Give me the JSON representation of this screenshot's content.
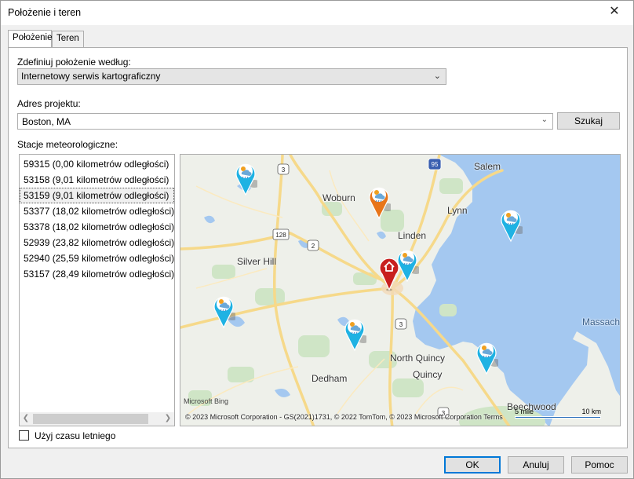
{
  "window": {
    "title": "Położenie i teren",
    "close_glyph": "✕"
  },
  "tabs": [
    {
      "label": "Położenie",
      "active": true
    },
    {
      "label": "Teren",
      "active": false
    }
  ],
  "location": {
    "define_label": "Zdefiniuj położenie według:",
    "define_value": "Internetowy serwis kartograficzny",
    "address_label": "Adres projektu:",
    "address_value": "Boston, MA",
    "search_button": "Szukaj"
  },
  "stations": {
    "label": "Stacje meteorologiczne:",
    "selected_index": 2,
    "items": [
      "59315 (0,00 kilometrów odległości)",
      "53158 (9,01 kilometrów odległości)",
      "53159 (9,01 kilometrów odległości)",
      "53377 (18,02 kilometrów odległości)",
      "53378 (18,02 kilometrów odległości)",
      "52939 (23,82 kilometrów odległości)",
      "52940 (25,59 kilometrów odległości)",
      "53157 (28,49 kilometrów odległości)"
    ]
  },
  "map": {
    "place_labels": [
      "Salem",
      "Woburn",
      "Lynn",
      "Linden",
      "Silver Hill",
      "North Quincy",
      "Quincy",
      "Dedham",
      "Beechwood",
      "Massach"
    ],
    "route_shields": [
      "3",
      "95",
      "128",
      "2",
      "3",
      "3"
    ],
    "bing_logo": "Microsoft Bing",
    "copyright": "© 2023 Microsoft Corporation - GS(2021)1731, © 2022 TomTom, © 2023 Microsoft Corporation  Terms",
    "scale_miles": "5 mile",
    "scale_km": "10 km",
    "colors": {
      "water": "#a4c8f0",
      "land": "#eef0ea",
      "park": "#cfe5c6",
      "road": "#f6d98a",
      "pin_weather": "#1fb2e3",
      "pin_selected": "#e8751a",
      "pin_home": "#c8201f"
    },
    "pins": [
      {
        "name": "weather-pin",
        "icon": "weather-icon",
        "type": "weather"
      },
      {
        "name": "weather-pin-selected",
        "icon": "weather-icon",
        "type": "selected"
      },
      {
        "name": "weather-pin",
        "icon": "weather-icon",
        "type": "weather"
      },
      {
        "name": "weather-pin",
        "icon": "weather-icon",
        "type": "weather"
      },
      {
        "name": "weather-pin",
        "icon": "weather-icon",
        "type": "weather"
      },
      {
        "name": "weather-pin",
        "icon": "weather-icon",
        "type": "weather"
      },
      {
        "name": "weather-pin",
        "icon": "weather-icon",
        "type": "weather"
      },
      {
        "name": "project-home-pin",
        "icon": "home-icon",
        "type": "home"
      }
    ]
  },
  "options": {
    "dst_label": "Użyj czasu letniego",
    "dst_checked": false
  },
  "buttons": {
    "ok": "OK",
    "cancel": "Anuluj",
    "help": "Pomoc"
  }
}
